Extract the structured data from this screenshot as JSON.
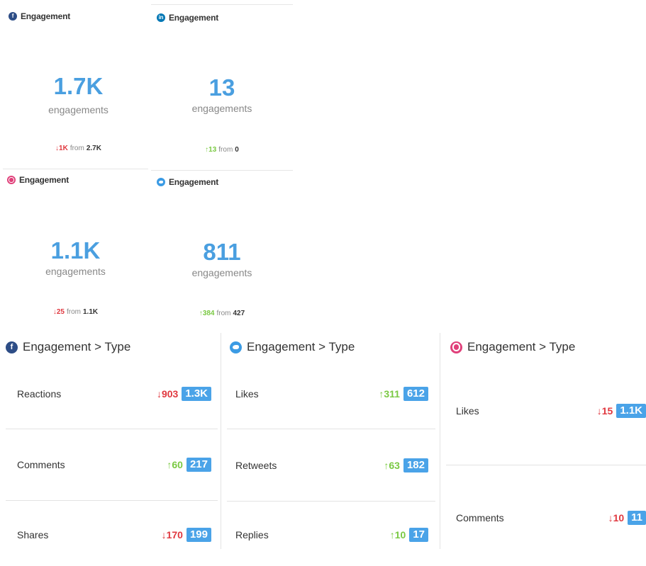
{
  "cards": [
    {
      "network": "facebook",
      "icon": "facebook-icon",
      "title": "Engagement",
      "value": "1.7K",
      "unit": "engagements",
      "direction": "down",
      "change": "↓1K",
      "from_label": "from",
      "previous": "2.7K"
    },
    {
      "network": "linkedin",
      "icon": "linkedin-icon",
      "title": "Engagement",
      "value": "13",
      "unit": "engagements",
      "direction": "up",
      "change": "↑13",
      "from_label": "from",
      "previous": "0"
    },
    {
      "network": "instagram",
      "icon": "instagram-icon",
      "title": "Engagement",
      "value": "1.1K",
      "unit": "engagements",
      "direction": "down",
      "change": "↓25",
      "from_label": "from",
      "previous": "1.1K"
    },
    {
      "network": "twitter",
      "icon": "twitter-icon",
      "title": "Engagement",
      "value": "811",
      "unit": "engagements",
      "direction": "up",
      "change": "↑384",
      "from_label": "from",
      "previous": "427"
    }
  ],
  "panels": [
    {
      "network": "facebook",
      "icon": "facebook-icon",
      "title": "Engagement > Type",
      "rows": [
        {
          "label": "Reactions",
          "direction": "down",
          "change": "↓903",
          "value": "1.3K"
        },
        {
          "label": "Comments",
          "direction": "up",
          "change": "↑60",
          "value": "217"
        },
        {
          "label": "Shares",
          "direction": "down",
          "change": "↓170",
          "value": "199"
        }
      ]
    },
    {
      "network": "twitter",
      "icon": "twitter-icon",
      "title": "Engagement > Type",
      "rows": [
        {
          "label": "Likes",
          "direction": "up",
          "change": "↑311",
          "value": "612"
        },
        {
          "label": "Retweets",
          "direction": "up",
          "change": "↑63",
          "value": "182"
        },
        {
          "label": "Replies",
          "direction": "up",
          "change": "↑10",
          "value": "17"
        }
      ]
    },
    {
      "network": "instagram",
      "icon": "instagram-icon",
      "title": "Engagement > Type",
      "rows": [
        {
          "label": "Likes",
          "direction": "down",
          "change": "↓15",
          "value": "1.1K"
        },
        {
          "label": "Comments",
          "direction": "down",
          "change": "↓10",
          "value": "11"
        }
      ]
    }
  ],
  "colors": {
    "value_blue": "#4a9fe0",
    "down_red": "#e0383f",
    "up_green": "#7ac943",
    "badge_blue": "#4aa3e8"
  }
}
